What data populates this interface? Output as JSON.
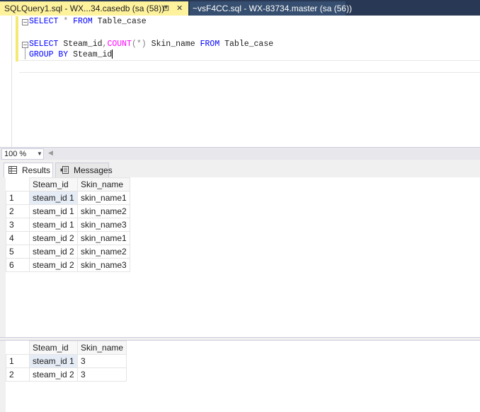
{
  "tabs": [
    {
      "label": "SQLQuery1.sql - WX...34.casedb (sa (58))*",
      "pin": "⊡",
      "close": "✕",
      "active": true
    },
    {
      "label": "~vsF4CC.sql - WX-83734.master (sa (56))",
      "active": false
    }
  ],
  "editor": {
    "line1": {
      "kw1": "SELECT",
      "op1": " *",
      "kw2": "FROM",
      "rest": " Table_case"
    },
    "line3": {
      "kw1": "SELECT",
      "t1": " Steam_id",
      "op1": ",",
      "fn1": "COUNT",
      "op2": "(*)",
      "t2": " Skin_name ",
      "kw2": "FROM",
      "t3": " Table_case"
    },
    "line4": {
      "kw1": "GROUP BY",
      "t1": " Steam_id"
    }
  },
  "zoom": {
    "value": "100 %"
  },
  "result_tabs": {
    "results": "Results",
    "messages": "Messages"
  },
  "grid1": {
    "columns": [
      "Steam_id",
      "Skin_name"
    ],
    "rows": [
      {
        "n": "1",
        "steam_id": "steam_id 1",
        "skin_name": "skin_name1"
      },
      {
        "n": "2",
        "steam_id": "steam_id 1",
        "skin_name": "skin_name2"
      },
      {
        "n": "3",
        "steam_id": "steam_id 1",
        "skin_name": "skin_name3"
      },
      {
        "n": "4",
        "steam_id": "steam_id 2",
        "skin_name": "skin_name1"
      },
      {
        "n": "5",
        "steam_id": "steam_id 2",
        "skin_name": "skin_name2"
      },
      {
        "n": "6",
        "steam_id": "steam_id 2",
        "skin_name": "skin_name3"
      }
    ]
  },
  "grid2": {
    "columns": [
      "Steam_id",
      "Skin_name"
    ],
    "rows": [
      {
        "n": "1",
        "steam_id": "steam_id 1",
        "skin_name": "3"
      },
      {
        "n": "2",
        "steam_id": "steam_id 2",
        "skin_name": "3"
      }
    ]
  },
  "colors": {
    "active_tab": "#fff29d",
    "tabstrip": "#293955",
    "keyword": "#0000ff",
    "function": "#ff00ff"
  }
}
